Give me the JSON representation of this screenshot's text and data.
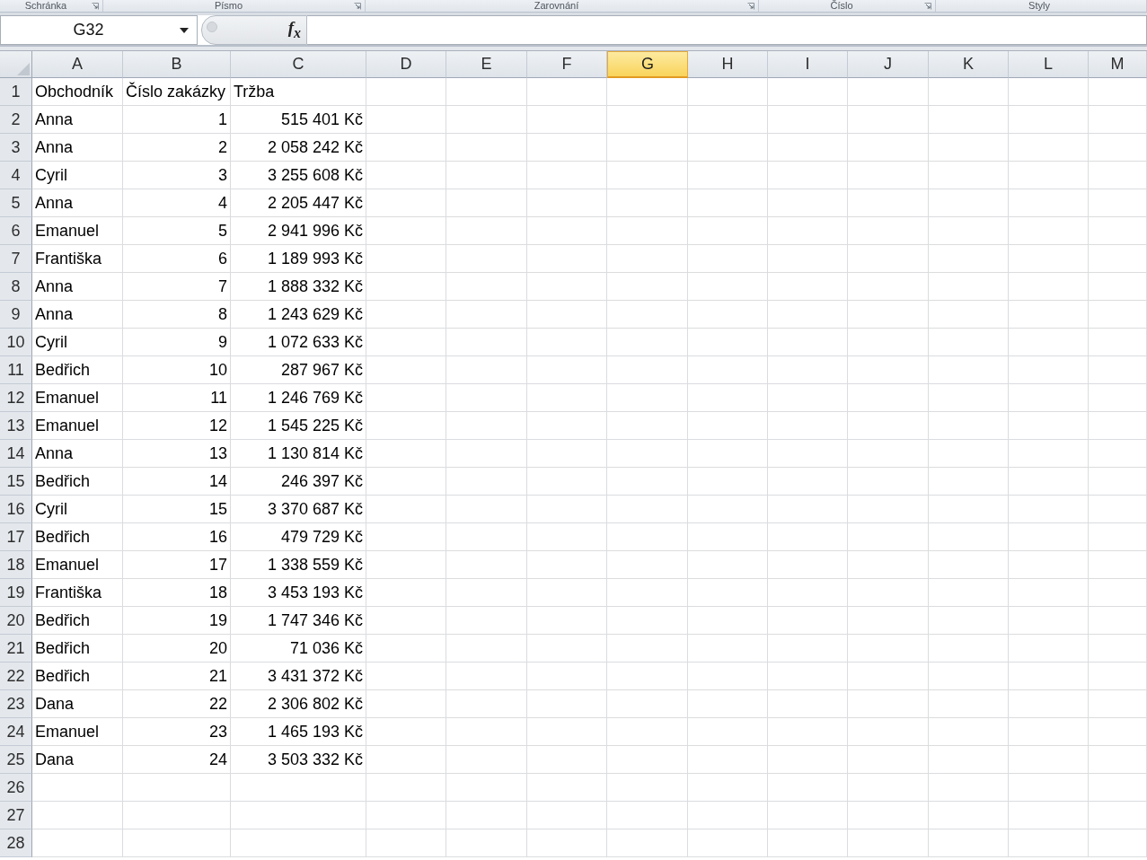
{
  "ribbon_groups": [
    {
      "label": "Schránka",
      "launcher": true
    },
    {
      "label": "Písmo",
      "launcher": true
    },
    {
      "label": "Zarovnání",
      "launcher": true
    },
    {
      "label": "Číslo",
      "launcher": true
    },
    {
      "label": "Styly",
      "launcher": false
    }
  ],
  "name_box": {
    "value": "G32"
  },
  "formula_bar": {
    "function_button": "f$_{x}$"
  },
  "sheet": {
    "columns": [
      {
        "label": "A",
        "selected": false
      },
      {
        "label": "B",
        "selected": false
      },
      {
        "label": "C",
        "selected": false
      },
      {
        "label": "D",
        "selected": false
      },
      {
        "label": "E",
        "selected": false
      },
      {
        "label": "F",
        "selected": false
      },
      {
        "label": "G",
        "selected": true
      },
      {
        "label": "H",
        "selected": false
      },
      {
        "label": "I",
        "selected": false
      },
      {
        "label": "J",
        "selected": false
      },
      {
        "label": "K",
        "selected": false
      },
      {
        "label": "L",
        "selected": false
      },
      {
        "label": "M",
        "selected": false
      }
    ],
    "rows": [
      {
        "header": "1",
        "cells": [
          {
            "value": "Obchodník",
            "kind": "text"
          },
          {
            "value": "Číslo zakázky",
            "kind": "text"
          },
          {
            "value": "Tržba",
            "kind": "text"
          }
        ]
      },
      {
        "header": "2",
        "cells": [
          {
            "value": "Anna",
            "kind": "text"
          },
          {
            "value": "1",
            "kind": "number"
          },
          {
            "value": "515 401 Kč",
            "kind": "number"
          }
        ]
      },
      {
        "header": "3",
        "cells": [
          {
            "value": "Anna",
            "kind": "text"
          },
          {
            "value": "2",
            "kind": "number"
          },
          {
            "value": "2 058 242 Kč",
            "kind": "number"
          }
        ]
      },
      {
        "header": "4",
        "cells": [
          {
            "value": "Cyril",
            "kind": "text"
          },
          {
            "value": "3",
            "kind": "number"
          },
          {
            "value": "3 255 608 Kč",
            "kind": "number"
          }
        ]
      },
      {
        "header": "5",
        "cells": [
          {
            "value": "Anna",
            "kind": "text"
          },
          {
            "value": "4",
            "kind": "number"
          },
          {
            "value": "2 205 447 Kč",
            "kind": "number"
          }
        ]
      },
      {
        "header": "6",
        "cells": [
          {
            "value": "Emanuel",
            "kind": "text"
          },
          {
            "value": "5",
            "kind": "number"
          },
          {
            "value": "2 941 996 Kč",
            "kind": "number"
          }
        ]
      },
      {
        "header": "7",
        "cells": [
          {
            "value": "Františka",
            "kind": "text"
          },
          {
            "value": "6",
            "kind": "number"
          },
          {
            "value": "1 189 993 Kč",
            "kind": "number"
          }
        ]
      },
      {
        "header": "8",
        "cells": [
          {
            "value": "Anna",
            "kind": "text"
          },
          {
            "value": "7",
            "kind": "number"
          },
          {
            "value": "1 888 332 Kč",
            "kind": "number"
          }
        ]
      },
      {
        "header": "9",
        "cells": [
          {
            "value": "Anna",
            "kind": "text"
          },
          {
            "value": "8",
            "kind": "number"
          },
          {
            "value": "1 243 629 Kč",
            "kind": "number"
          }
        ]
      },
      {
        "header": "10",
        "cells": [
          {
            "value": "Cyril",
            "kind": "text"
          },
          {
            "value": "9",
            "kind": "number"
          },
          {
            "value": "1 072 633 Kč",
            "kind": "number"
          }
        ]
      },
      {
        "header": "11",
        "cells": [
          {
            "value": "Bedřich",
            "kind": "text"
          },
          {
            "value": "10",
            "kind": "number"
          },
          {
            "value": "287 967 Kč",
            "kind": "number"
          }
        ]
      },
      {
        "header": "12",
        "cells": [
          {
            "value": "Emanuel",
            "kind": "text"
          },
          {
            "value": "11",
            "kind": "number"
          },
          {
            "value": "1 246 769 Kč",
            "kind": "number"
          }
        ]
      },
      {
        "header": "13",
        "cells": [
          {
            "value": "Emanuel",
            "kind": "text"
          },
          {
            "value": "12",
            "kind": "number"
          },
          {
            "value": "1 545 225 Kč",
            "kind": "number"
          }
        ]
      },
      {
        "header": "14",
        "cells": [
          {
            "value": "Anna",
            "kind": "text"
          },
          {
            "value": "13",
            "kind": "number"
          },
          {
            "value": "1 130 814 Kč",
            "kind": "number"
          }
        ]
      },
      {
        "header": "15",
        "cells": [
          {
            "value": "Bedřich",
            "kind": "text"
          },
          {
            "value": "14",
            "kind": "number"
          },
          {
            "value": "246 397 Kč",
            "kind": "number"
          }
        ]
      },
      {
        "header": "16",
        "cells": [
          {
            "value": "Cyril",
            "kind": "text"
          },
          {
            "value": "15",
            "kind": "number"
          },
          {
            "value": "3 370 687 Kč",
            "kind": "number"
          }
        ]
      },
      {
        "header": "17",
        "cells": [
          {
            "value": "Bedřich",
            "kind": "text"
          },
          {
            "value": "16",
            "kind": "number"
          },
          {
            "value": "479 729 Kč",
            "kind": "number"
          }
        ]
      },
      {
        "header": "18",
        "cells": [
          {
            "value": "Emanuel",
            "kind": "text"
          },
          {
            "value": "17",
            "kind": "number"
          },
          {
            "value": "1 338 559 Kč",
            "kind": "number"
          }
        ]
      },
      {
        "header": "19",
        "cells": [
          {
            "value": "Františka",
            "kind": "text"
          },
          {
            "value": "18",
            "kind": "number"
          },
          {
            "value": "3 453 193 Kč",
            "kind": "number"
          }
        ]
      },
      {
        "header": "20",
        "cells": [
          {
            "value": "Bedřich",
            "kind": "text"
          },
          {
            "value": "19",
            "kind": "number"
          },
          {
            "value": "1 747 346 Kč",
            "kind": "number"
          }
        ]
      },
      {
        "header": "21",
        "cells": [
          {
            "value": "Bedřich",
            "kind": "text"
          },
          {
            "value": "20",
            "kind": "number"
          },
          {
            "value": "71 036 Kč",
            "kind": "number"
          }
        ]
      },
      {
        "header": "22",
        "cells": [
          {
            "value": "Bedřich",
            "kind": "text"
          },
          {
            "value": "21",
            "kind": "number"
          },
          {
            "value": "3 431 372 Kč",
            "kind": "number"
          }
        ]
      },
      {
        "header": "23",
        "cells": [
          {
            "value": "Dana",
            "kind": "text"
          },
          {
            "value": "22",
            "kind": "number"
          },
          {
            "value": "2 306 802 Kč",
            "kind": "number"
          }
        ]
      },
      {
        "header": "24",
        "cells": [
          {
            "value": "Emanuel",
            "kind": "text"
          },
          {
            "value": "23",
            "kind": "number"
          },
          {
            "value": "1 465 193 Kč",
            "kind": "number"
          }
        ]
      },
      {
        "header": "25",
        "cells": [
          {
            "value": "Dana",
            "kind": "text"
          },
          {
            "value": "24",
            "kind": "number"
          },
          {
            "value": "3 503 332 Kč",
            "kind": "number"
          }
        ]
      },
      {
        "header": "26",
        "cells": []
      },
      {
        "header": "27",
        "cells": []
      },
      {
        "header": "28",
        "cells": []
      }
    ]
  }
}
